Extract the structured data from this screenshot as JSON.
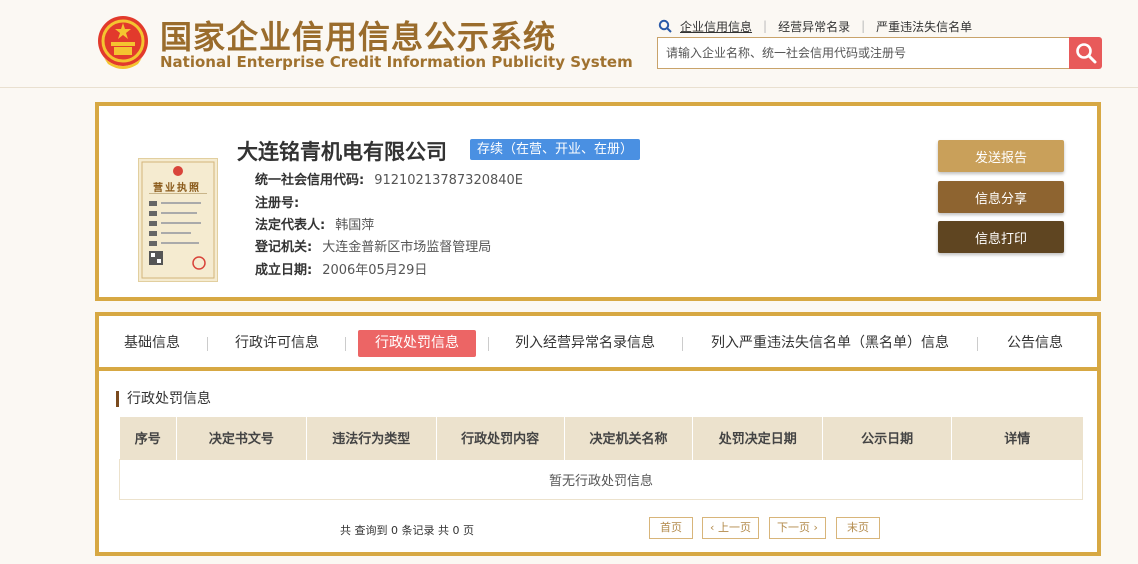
{
  "header": {
    "title": "国家企业信用信息公示系统",
    "subtitle": "National Enterprise Credit Information Publicity System",
    "nav": [
      {
        "label": "企业信用信息"
      },
      {
        "label": "经营异常名录"
      },
      {
        "label": "严重违法失信名单"
      }
    ],
    "search_placeholder": "请输入企业名称、统一社会信用代码或注册号"
  },
  "company": {
    "name": "大连铭青机电有限公司",
    "status": "存续（在营、开业、在册）",
    "fields": [
      {
        "label": "统一社会信用代码:",
        "value": "91210213787320840E"
      },
      {
        "label": "注册号:",
        "value": ""
      },
      {
        "label": "法定代表人:",
        "value": "韩国萍"
      },
      {
        "label": "登记机关:",
        "value": "大连金普新区市场监督管理局"
      },
      {
        "label": "成立日期:",
        "value": "2006年05月29日"
      }
    ],
    "license_text": "营业执照"
  },
  "actions": [
    {
      "label": "发送报告"
    },
    {
      "label": "信息分享"
    },
    {
      "label": "信息打印"
    }
  ],
  "tabs": [
    {
      "label": "基础信息"
    },
    {
      "label": "行政许可信息"
    },
    {
      "label": "行政处罚信息"
    },
    {
      "label": "列入经营异常名录信息"
    },
    {
      "label": "列入严重违法失信名单（黑名单）信息"
    },
    {
      "label": "公告信息"
    }
  ],
  "penalty": {
    "section_title": "行政处罚信息",
    "columns": [
      "序号",
      "决定书文号",
      "违法行为类型",
      "行政处罚内容",
      "决定机关名称",
      "处罚决定日期",
      "公示日期",
      "详情"
    ],
    "empty_text": "暂无行政处罚信息",
    "count_text": "共 查询到 0 条记录 共 0 页",
    "pager": {
      "first": "首页",
      "prev": "上一页",
      "next": "下一页",
      "last": "末页"
    }
  },
  "colors": {
    "accent_gold": "#d7a843",
    "badge_blue": "#4a90e2",
    "active_tab": "#ec6565",
    "btn_report": "#c9a05a",
    "btn_share": "#8e6430",
    "btn_print": "#5f4521"
  }
}
